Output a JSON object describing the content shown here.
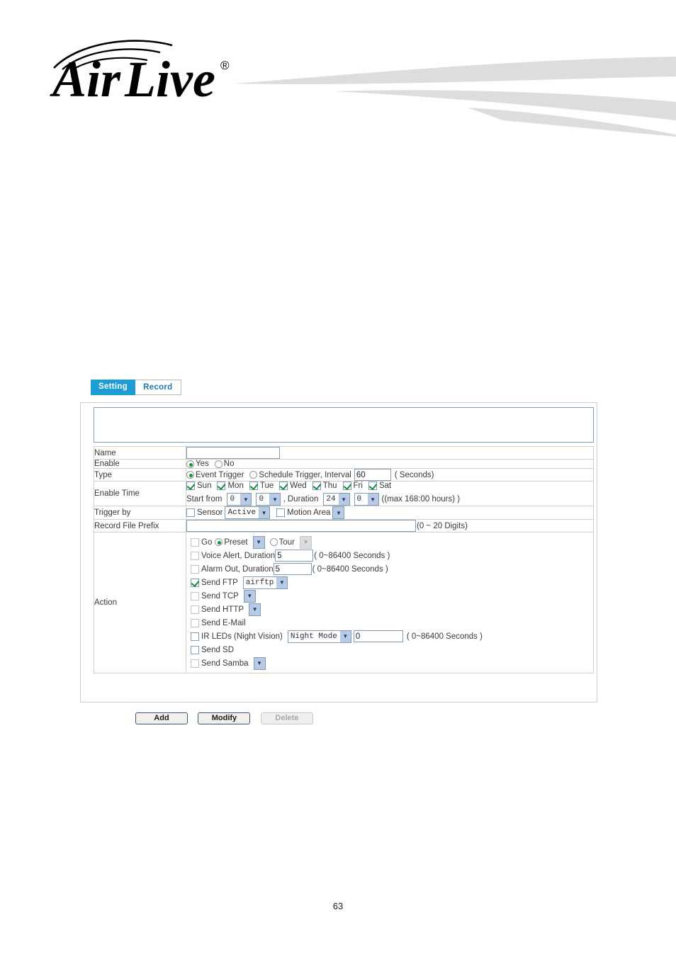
{
  "header": {
    "logo_text": "Air Live",
    "logo_trademark": "®"
  },
  "tabs": [
    {
      "label": "Setting",
      "active": true
    },
    {
      "label": "Record",
      "active": false
    }
  ],
  "form": {
    "rows": {
      "name": {
        "label": "Name",
        "value": ""
      },
      "enable": {
        "label": "Enable",
        "yes": "Yes",
        "no": "No",
        "selected": "Yes"
      },
      "type": {
        "label": "Type",
        "event_trigger": "Event Trigger",
        "schedule_trigger": "Schedule Trigger, Interval",
        "selected": "Event Trigger",
        "interval": "60",
        "seconds_hint": "( Seconds)"
      },
      "enable_time": {
        "label": "Enable Time",
        "days": [
          {
            "label": "Sun",
            "checked": true
          },
          {
            "label": "Mon",
            "checked": true
          },
          {
            "label": "Tue",
            "checked": true
          },
          {
            "label": "Wed",
            "checked": true
          },
          {
            "label": "Thu",
            "checked": true
          },
          {
            "label": "Fri",
            "checked": true
          },
          {
            "label": "Sat",
            "checked": true
          }
        ],
        "start_from_label": "Start from",
        "start_hour": "0",
        "start_minute": "0",
        "duration_label": ", Duration",
        "duration_hour": "24",
        "duration_minute": "0",
        "max_hint": "((max 168:00 hours) )"
      },
      "trigger_by": {
        "label": "Trigger by",
        "sensor_label": "Sensor",
        "sensor_checked": false,
        "sensor_mode": "Active",
        "motion_area_label": "Motion Area",
        "motion_area_checked": false,
        "motion_area_value": ""
      },
      "record_file_prefix": {
        "label": "Record File Prefix",
        "value": "",
        "hint": "(0 ~ 20 Digits)"
      },
      "action": {
        "label": "Action",
        "items": [
          {
            "id": "go",
            "label": "Go",
            "checked": false,
            "preset_label": "Preset",
            "preset_selected": true,
            "preset_value": "",
            "tour_label": "Tour",
            "tour_selected": false,
            "tour_value": ""
          },
          {
            "id": "voice-alert",
            "label": "Voice Alert, Duration",
            "checked": false,
            "value": "5",
            "hint": "( 0~86400 Seconds )"
          },
          {
            "id": "alarm-out",
            "label": "Alarm Out, Duration",
            "checked": false,
            "value": "5",
            "hint": "( 0~86400 Seconds )"
          },
          {
            "id": "send-ftp",
            "label": "Send FTP",
            "checked": true,
            "select_value": "airftp"
          },
          {
            "id": "send-tcp",
            "label": "Send TCP",
            "checked": false,
            "select_value": ""
          },
          {
            "id": "send-http",
            "label": "Send HTTP",
            "checked": false,
            "select_value": ""
          },
          {
            "id": "send-email",
            "label": "Send E-Mail",
            "checked": false
          },
          {
            "id": "ir-leds",
            "label": "IR LEDs (Night Vision)",
            "checked": false,
            "select_value": "Night Mode",
            "value": "0",
            "hint": "( 0~86400 Seconds )"
          },
          {
            "id": "send-sd",
            "label": "Send SD",
            "checked": false
          },
          {
            "id": "send-samba",
            "label": "Send Samba",
            "checked": false,
            "select_value": ""
          }
        ]
      }
    }
  },
  "buttons": {
    "add": "Add",
    "modify": "Modify",
    "delete": "Delete"
  },
  "footer": {
    "page_number": "63"
  },
  "colors": {
    "tab_active_bg": "#1f9cd4",
    "tab_inactive_text": "#1f7ab5",
    "check_green": "#1a8a38",
    "input_border": "#7f9db9",
    "swoosh_gray": "#dddddd"
  }
}
